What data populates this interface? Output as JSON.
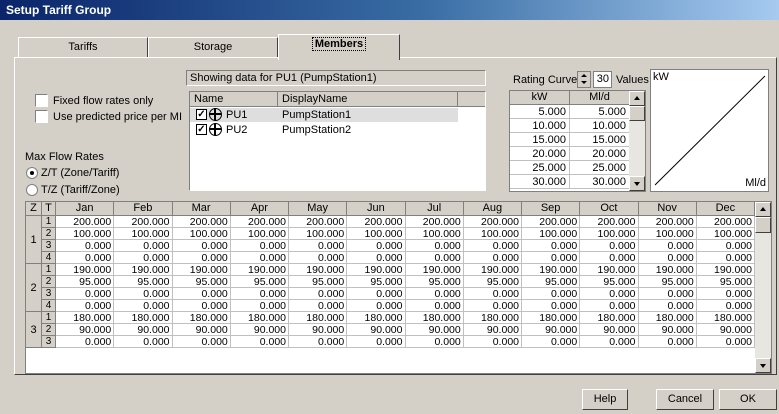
{
  "window": {
    "title": "Setup Tariff Group"
  },
  "tabs": [
    {
      "label": "Tariffs",
      "active": false
    },
    {
      "label": "Storage",
      "active": false
    },
    {
      "label": "Members",
      "active": true
    }
  ],
  "options": {
    "fixed_flow_label": "Fixed flow rates only",
    "fixed_flow_checked": false,
    "predicted_price_label": "Use predicted price per MI",
    "predicted_price_checked": false
  },
  "max_flow": {
    "title": "Max Flow Rates",
    "option1": "Z/T (Zone/Tariff)",
    "option2": "T/Z (Tariff/Zone)",
    "selected": 1
  },
  "members": {
    "info": "Showing data for PU1 (PumpStation1)",
    "columns": [
      "Name",
      "DisplayName"
    ],
    "rows": [
      {
        "name": "PU1",
        "display": "PumpStation1",
        "checked": true,
        "selected": true
      },
      {
        "name": "PU2",
        "display": "PumpStation2",
        "checked": true,
        "selected": false
      }
    ]
  },
  "rating_curve": {
    "label": "Rating Curve",
    "count": "30",
    "values_label": "Values",
    "columns": [
      "kW",
      "Ml/d"
    ],
    "rows": [
      [
        "5.000",
        "5.000"
      ],
      [
        "10.000",
        "10.000"
      ],
      [
        "15.000",
        "15.000"
      ],
      [
        "20.000",
        "20.000"
      ],
      [
        "25.000",
        "25.000"
      ],
      [
        "30.000",
        "30.000"
      ]
    ]
  },
  "graph": {
    "y_label": "kW",
    "x_label": "Ml/d"
  },
  "grid": {
    "z_header": "Z",
    "t_header": "T",
    "months": [
      "Jan",
      "Feb",
      "Mar",
      "Apr",
      "May",
      "Jun",
      "Jul",
      "Aug",
      "Sep",
      "Oct",
      "Nov",
      "Dec"
    ],
    "zones": [
      {
        "z": "1",
        "rows": [
          {
            "t": "1",
            "value": "200.000"
          },
          {
            "t": "2",
            "value": "100.000"
          },
          {
            "t": "3",
            "value": "0.000"
          },
          {
            "t": "4",
            "value": "0.000"
          }
        ]
      },
      {
        "z": "2",
        "rows": [
          {
            "t": "1",
            "value": "190.000"
          },
          {
            "t": "2",
            "value": "95.000"
          },
          {
            "t": "3",
            "value": "0.000"
          },
          {
            "t": "4",
            "value": "0.000"
          }
        ]
      },
      {
        "z": "3",
        "rows": [
          {
            "t": "1",
            "value": "180.000"
          },
          {
            "t": "2",
            "value": "90.000"
          },
          {
            "t": "3",
            "value": "0.000"
          }
        ]
      }
    ]
  },
  "buttons": {
    "help": "Help",
    "cancel": "Cancel",
    "ok": "OK"
  }
}
